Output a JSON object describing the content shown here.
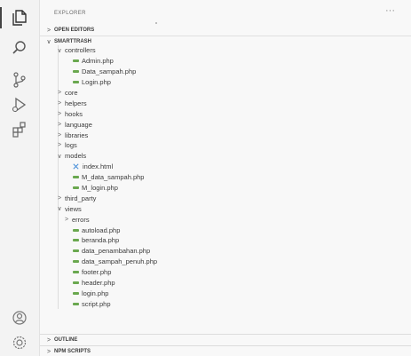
{
  "explorer": {
    "title": "EXPLORER",
    "more_label": "···",
    "sections": {
      "open_editors": "OPEN EDITORS",
      "project": "SMARTTRASH",
      "outline": "OUTLINE",
      "npm_scripts": "NPM SCRIPTS"
    },
    "tree": [
      {
        "label": "controllers",
        "type": "folder",
        "open": true,
        "depth": 1
      },
      {
        "label": "Admin.php",
        "type": "php",
        "depth": 2
      },
      {
        "label": "Data_sampah.php",
        "type": "php",
        "depth": 2
      },
      {
        "label": "Login.php",
        "type": "php",
        "depth": 2
      },
      {
        "label": "core",
        "type": "folder",
        "open": false,
        "depth": 1
      },
      {
        "label": "helpers",
        "type": "folder",
        "open": false,
        "depth": 1
      },
      {
        "label": "hooks",
        "type": "folder",
        "open": false,
        "depth": 1
      },
      {
        "label": "language",
        "type": "folder",
        "open": false,
        "depth": 1
      },
      {
        "label": "libraries",
        "type": "folder",
        "open": false,
        "depth": 1
      },
      {
        "label": "logs",
        "type": "folder",
        "open": false,
        "depth": 1
      },
      {
        "label": "models",
        "type": "folder",
        "open": true,
        "depth": 1
      },
      {
        "label": "index.html",
        "type": "html",
        "depth": 2
      },
      {
        "label": "M_data_sampah.php",
        "type": "php",
        "depth": 2
      },
      {
        "label": "M_login.php",
        "type": "php",
        "depth": 2
      },
      {
        "label": "third_party",
        "type": "folder",
        "open": false,
        "depth": 1
      },
      {
        "label": "views",
        "type": "folder",
        "open": true,
        "depth": 1
      },
      {
        "label": "errors",
        "type": "folder",
        "open": false,
        "depth": 2
      },
      {
        "label": "autoload.php",
        "type": "php",
        "depth": 2
      },
      {
        "label": "beranda.php",
        "type": "php",
        "depth": 2
      },
      {
        "label": "data_penambahan.php",
        "type": "php",
        "depth": 2
      },
      {
        "label": "data_sampah_penuh.php",
        "type": "php",
        "depth": 2
      },
      {
        "label": "footer.php",
        "type": "php",
        "depth": 2
      },
      {
        "label": "header.php",
        "type": "php",
        "depth": 2
      },
      {
        "label": "login.php",
        "type": "php",
        "depth": 2
      },
      {
        "label": "script.php",
        "type": "php",
        "depth": 2
      }
    ]
  },
  "activity_bar": {
    "icons": [
      "files-icon",
      "search-icon",
      "source-control-icon",
      "run-debug-icon",
      "extensions-icon",
      "account-icon",
      "settings-gear-icon"
    ]
  },
  "colors": {
    "php": "#6aa84f",
    "html": "#4a90d9",
    "background": "#f8f8f8"
  }
}
